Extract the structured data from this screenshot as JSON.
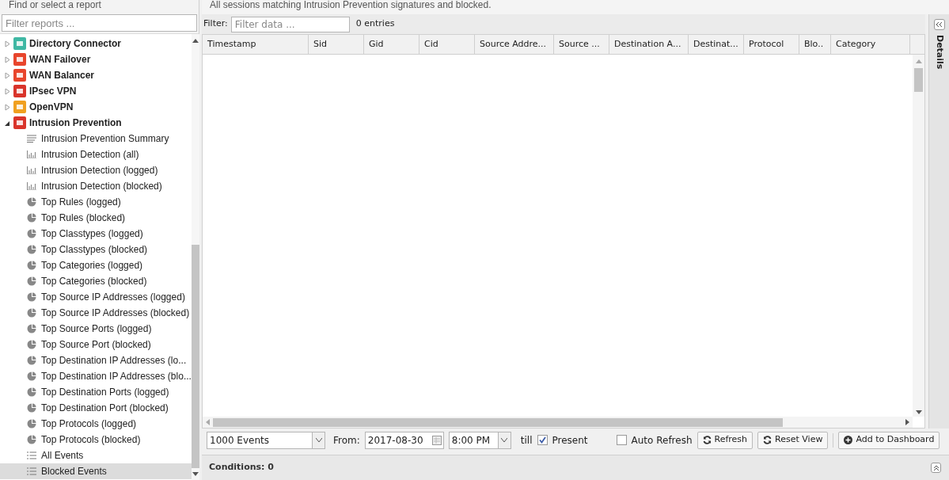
{
  "sidebar": {
    "title": "Find or select a report",
    "filter": {
      "placeholder": "Filter reports ..."
    },
    "tree": [
      {
        "label": "Directory Connector",
        "expanded": false,
        "selected": false
      },
      {
        "label": "WAN Failover",
        "expanded": false,
        "selected": false
      },
      {
        "label": "WAN Balancer",
        "expanded": false,
        "selected": false
      },
      {
        "label": "IPsec VPN",
        "expanded": false,
        "selected": false
      },
      {
        "label": "OpenVPN",
        "expanded": false,
        "selected": false
      },
      {
        "label": "Intrusion Prevention",
        "expanded": true,
        "selected": false,
        "children": [
          {
            "label": "Intrusion Prevention Summary",
            "kind": "text",
            "selected": false
          },
          {
            "label": "Intrusion Detection (all)",
            "kind": "bar",
            "selected": false
          },
          {
            "label": "Intrusion Detection (logged)",
            "kind": "bar",
            "selected": false
          },
          {
            "label": "Intrusion Detection (blocked)",
            "kind": "bar",
            "selected": false
          },
          {
            "label": "Top Rules (logged)",
            "kind": "pie",
            "selected": false
          },
          {
            "label": "Top Rules (blocked)",
            "kind": "pie",
            "selected": false
          },
          {
            "label": "Top Classtypes (logged)",
            "kind": "pie",
            "selected": false
          },
          {
            "label": "Top Classtypes (blocked)",
            "kind": "pie",
            "selected": false
          },
          {
            "label": "Top Categories (logged)",
            "kind": "pie",
            "selected": false
          },
          {
            "label": "Top Categories (blocked)",
            "kind": "pie",
            "selected": false
          },
          {
            "label": "Top Source IP Addresses (logged)",
            "kind": "pie",
            "selected": false
          },
          {
            "label": "Top Source IP Addresses (blocked)",
            "kind": "pie",
            "selected": false
          },
          {
            "label": "Top Source Ports (logged)",
            "kind": "pie",
            "selected": false
          },
          {
            "label": "Top Source Port (blocked)",
            "kind": "pie",
            "selected": false
          },
          {
            "label": "Top Destination IP Addresses (lo...",
            "kind": "pie",
            "selected": false
          },
          {
            "label": "Top Destination IP Addresses (blo...",
            "kind": "pie",
            "selected": false
          },
          {
            "label": "Top Destination Ports (logged)",
            "kind": "pie",
            "selected": false
          },
          {
            "label": "Top Destination Port (blocked)",
            "kind": "pie",
            "selected": false
          },
          {
            "label": "Top Protocols (logged)",
            "kind": "pie",
            "selected": false
          },
          {
            "label": "Top Protocols (blocked)",
            "kind": "pie",
            "selected": false
          },
          {
            "label": "All Events",
            "kind": "list",
            "selected": false
          },
          {
            "label": "Blocked Events",
            "kind": "list",
            "selected": true
          }
        ]
      }
    ]
  },
  "description": "All sessions matching Intrusion Prevention signatures and blocked.",
  "filter_bar": {
    "label": "Filter:",
    "placeholder": "Filter data ...",
    "count": "0 entries"
  },
  "table": {
    "columns": [
      "Timestamp",
      "Sid",
      "Gid",
      "Cid",
      "Source Addre...",
      "Source ...",
      "Destination A...",
      "Destinat...",
      "Protocol",
      "Blo..",
      "Category"
    ]
  },
  "details_panel": {
    "title": "Details"
  },
  "toolbar": {
    "limit": "1000 Events",
    "from_label": "From:",
    "date": "2017-08-30",
    "time": "8:00 PM",
    "till_label": "till",
    "present": {
      "label": "Present",
      "checked": true
    },
    "auto_refresh": {
      "label": "Auto Refresh",
      "checked": false
    },
    "buttons": [
      "Refresh",
      "Reset View",
      "Add to Dashboard"
    ]
  },
  "conditions": "Conditions: 0"
}
